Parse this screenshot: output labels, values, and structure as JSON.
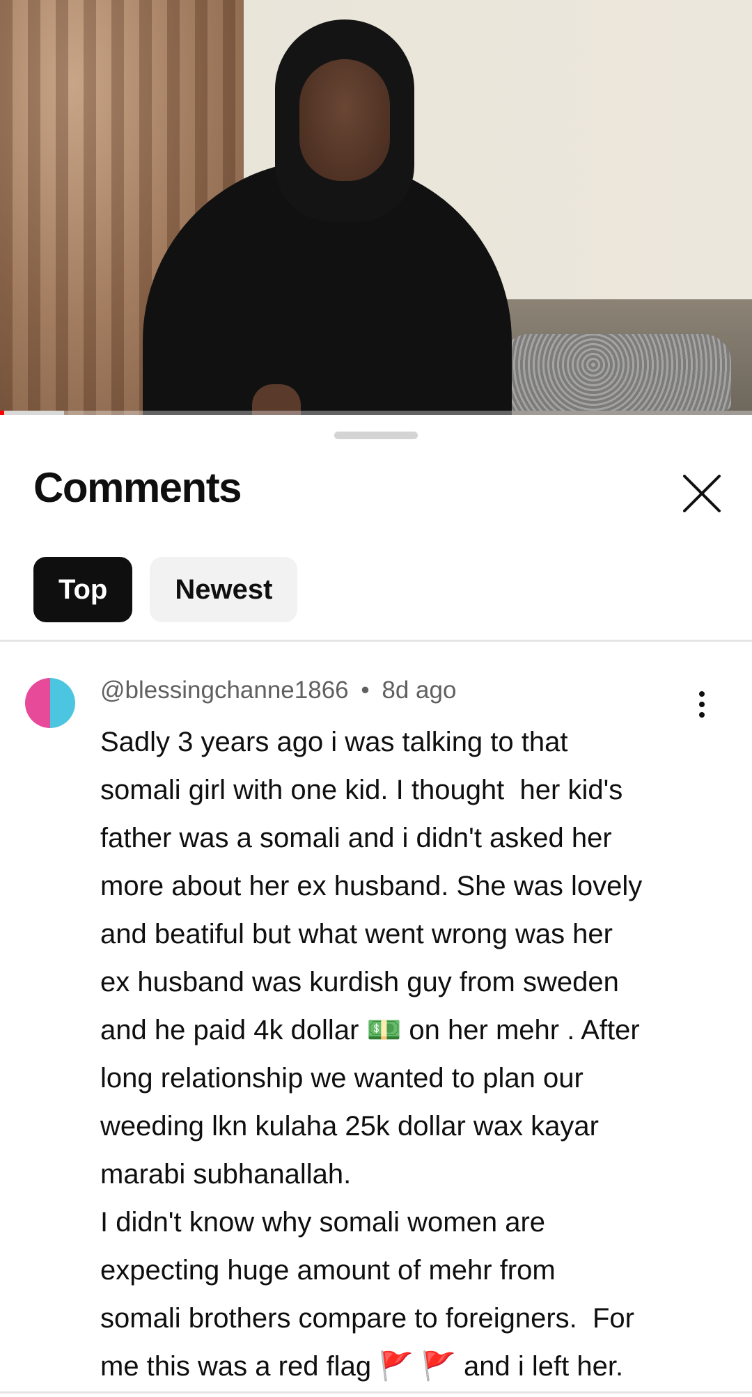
{
  "video": {
    "progress_fraction": 0.085
  },
  "sheet": {
    "title": "Comments",
    "close_icon": "close-icon",
    "tabs": [
      {
        "label": "Top",
        "active": true
      },
      {
        "label": "Newest",
        "active": false
      }
    ]
  },
  "comments": [
    {
      "author": "@blessingchanne1866",
      "separator": "•",
      "time": "8d ago",
      "avatar_colors": [
        "#e84a9a",
        "#4cc6e0"
      ],
      "more_icon": "more-vert-icon",
      "text": "Sadly 3 years ago i was talking to that\nsomali girl with one kid. I thought  her kid's\nfather was a somali and i didn't asked her\nmore about her ex husband. She was lovely\nand beatiful but what went wrong was her\nex husband was kurdish guy from sweden\nand he paid 4k dollar 💵 on her mehr . After\nlong relationship we wanted to plan our\nweeding lkn kulaha 25k dollar wax kayar\nmarabi subhanallah.\nI didn't know why somali women are\nexpecting huge amount of mehr from\nsomali brothers compare to foreigners.  For\nme this was a red flag 🚩 🚩 and i left her."
    }
  ]
}
